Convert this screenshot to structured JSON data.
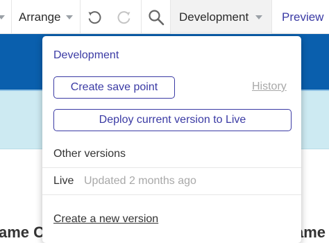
{
  "toolbar": {
    "arrange_label": "Arrange",
    "undo_icon": "undo-icon",
    "redo_icon": "redo-icon",
    "search_icon": "search-icon",
    "version_label": "Development",
    "preview_label": "Preview"
  },
  "background": {
    "left_text": "ame Cu",
    "right_text": "ame"
  },
  "dropdown": {
    "title": "Development",
    "save_point_button": "Create save point",
    "history_link": "History",
    "deploy_button": "Deploy current version to Live",
    "other_versions_label": "Other versions",
    "versions": [
      {
        "name": "Live",
        "status": "Updated 2 months ago"
      }
    ],
    "new_version_link": "Create a new version"
  },
  "colors": {
    "accent": "#3a3aa4",
    "header_blue": "#0a5fad",
    "light_band": "#cdeaf2",
    "muted_text": "#a8a8a8"
  }
}
